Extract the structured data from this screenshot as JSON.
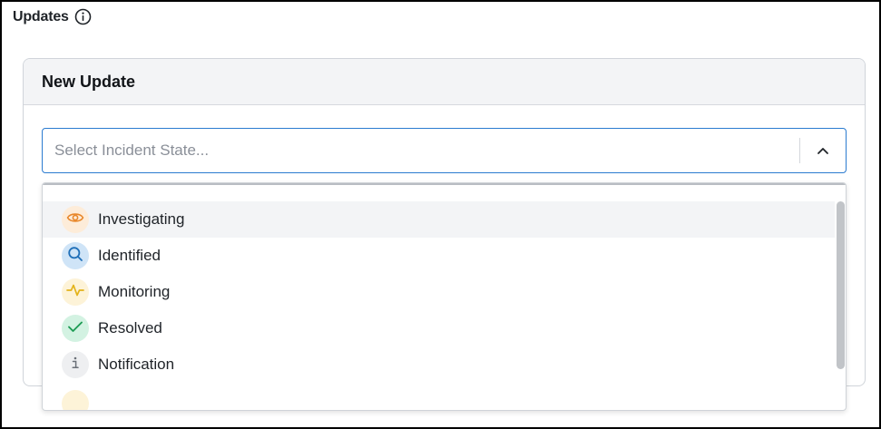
{
  "section": {
    "title": "Updates",
    "info_icon": "info-icon"
  },
  "card": {
    "title": "New Update"
  },
  "select": {
    "placeholder": "Select Incident State...",
    "chevron_icon": "chevron-up-icon"
  },
  "menu": {
    "items": [
      {
        "label": "Investigating",
        "icon": "eye-icon",
        "color": "#e8872a",
        "bg": "#fdecd9",
        "highlighted": true
      },
      {
        "label": "Identified",
        "icon": "search-icon",
        "color": "#1f6fb8",
        "bg": "#cfe4f7",
        "highlighted": false
      },
      {
        "label": "Monitoring",
        "icon": "pulse-icon",
        "color": "#e3b31a",
        "bg": "#fdf3d8",
        "highlighted": false
      },
      {
        "label": "Resolved",
        "icon": "check-icon",
        "color": "#1f9d55",
        "bg": "#d3f2e2",
        "highlighted": false
      },
      {
        "label": "Notification",
        "icon": "info-letter-icon",
        "color": "#6b7078",
        "bg": "#eeeff1",
        "highlighted": false
      }
    ]
  },
  "colors": {
    "accent": "#2b7bd0",
    "text": "#1f2328",
    "placeholder": "#8a8f98"
  }
}
